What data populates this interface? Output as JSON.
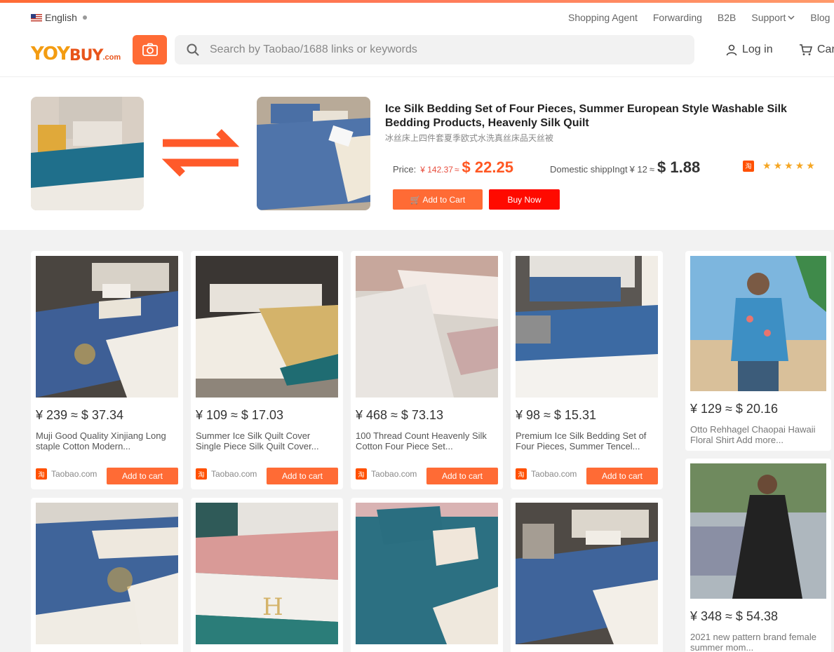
{
  "header": {
    "language": "English",
    "nav": [
      "Shopping Agent",
      "Forwarding",
      "B2B",
      "Support",
      "Blog"
    ],
    "logo_main": "YOY",
    "logo_second": "BUY",
    "logo_domain": ".com",
    "search_placeholder": "Search by Taobao/1688 links or keywords",
    "login": "Log in",
    "cart": "Cart"
  },
  "product": {
    "title": "Ice Silk Bedding Set of Four Pieces, Summer European Style Washable Silk Bedding Products, Heavenly Silk Quilt",
    "subtitle": "冰丝床上四件套夏季欧式水洗真丝床品天丝被",
    "price_label": "Price:",
    "price_cny": "¥ 142.37",
    "approx": "≈",
    "price_usd": "$ 22.25",
    "shipping_label": "Domestic shippIngt",
    "shipping_cny": "¥ 12",
    "shipping_usd": "$ 1.88",
    "rating_stars": 5,
    "add_to_cart": "Add to Cart",
    "buy_now": "Buy Now"
  },
  "grid": [
    {
      "price": "¥ 239 ≈ $ 37.34",
      "title": "Muji Good Quality Xinjiang Long staple Cotton Modern...",
      "source": "Taobao.com",
      "button": "Add to cart"
    },
    {
      "price": "¥ 109 ≈ $ 17.03",
      "title": "Summer Ice Silk Quilt Cover Single Piece Silk Quilt Cover...",
      "source": "Taobao.com",
      "button": "Add to cart"
    },
    {
      "price": "¥ 468 ≈ $ 73.13",
      "title": "100 Thread Count Heavenly Silk Cotton Four Piece Set...",
      "source": "Taobao.com",
      "button": "Add to cart"
    },
    {
      "price": "¥ 98 ≈ $ 15.31",
      "title": "Premium Ice Silk Bedding Set of Four Pieces, Summer Tencel...",
      "source": "Taobao.com",
      "button": "Add to cart"
    }
  ],
  "side": [
    {
      "price": "¥ 129 ≈ $ 20.16",
      "title": "Otto Rehhagel Chaopai Hawaii Floral Shirt Add more..."
    },
    {
      "price": "¥ 348 ≈ $ 54.38",
      "title": "2021 new pattern brand female summer mom..."
    }
  ],
  "badge_text": "淘",
  "colors": {
    "accent": "#ff6b35",
    "buy": "#ff0a00",
    "price": "#ff5722"
  }
}
